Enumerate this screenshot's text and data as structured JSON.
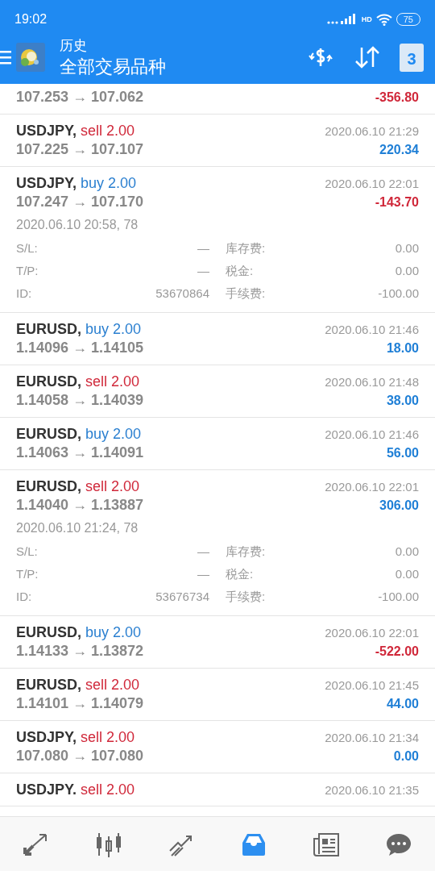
{
  "status_bar": {
    "time": "19:02",
    "network_badge": "HD",
    "battery": "75"
  },
  "header": {
    "title": "历史",
    "subtitle": "全部交易品种",
    "calendar_day": "3"
  },
  "trades": [
    {
      "prices": "107.253 → 107.062",
      "profit": "-356.80",
      "loss": true
    },
    {
      "symbol": "USDJPY,",
      "side": "sell",
      "volume": "2.00",
      "prices": "107.225 → 107.107",
      "time": "2020.06.10 21:29",
      "profit": "220.34",
      "loss": false
    },
    {
      "symbol": "USDJPY,",
      "side": "buy",
      "volume": "2.00",
      "prices": "107.247 → 107.170",
      "time": "2020.06.10 22:01",
      "profit": "-143.70",
      "loss": true,
      "details": {
        "opened": "2020.06.10 20:58, 78",
        "rows": [
          {
            "label": "S/L:",
            "value": "—",
            "label2": "库存费:",
            "value2": "0.00"
          },
          {
            "label": "T/P:",
            "value": "—",
            "label2": "税金:",
            "value2": "0.00"
          },
          {
            "label": "ID:",
            "value": "53670864",
            "label2": "手续费:",
            "value2": "-100.00"
          }
        ]
      }
    },
    {
      "symbol": "EURUSD,",
      "side": "buy",
      "volume": "2.00",
      "prices": "1.14096 → 1.14105",
      "time": "2020.06.10 21:46",
      "profit": "18.00",
      "loss": false
    },
    {
      "symbol": "EURUSD,",
      "side": "sell",
      "volume": "2.00",
      "prices": "1.14058 → 1.14039",
      "time": "2020.06.10 21:48",
      "profit": "38.00",
      "loss": false
    },
    {
      "symbol": "EURUSD,",
      "side": "buy",
      "volume": "2.00",
      "prices": "1.14063 → 1.14091",
      "time": "2020.06.10 21:46",
      "profit": "56.00",
      "loss": false
    },
    {
      "symbol": "EURUSD,",
      "side": "sell",
      "volume": "2.00",
      "prices": "1.14040 → 1.13887",
      "time": "2020.06.10 22:01",
      "profit": "306.00",
      "loss": false,
      "details": {
        "opened": "2020.06.10 21:24, 78",
        "rows": [
          {
            "label": "S/L:",
            "value": "—",
            "label2": "库存费:",
            "value2": "0.00"
          },
          {
            "label": "T/P:",
            "value": "—",
            "label2": "税金:",
            "value2": "0.00"
          },
          {
            "label": "ID:",
            "value": "53676734",
            "label2": "手续费:",
            "value2": "-100.00"
          }
        ]
      }
    },
    {
      "symbol": "EURUSD,",
      "side": "buy",
      "volume": "2.00",
      "prices": "1.14133 → 1.13872",
      "time": "2020.06.10 22:01",
      "profit": "-522.00",
      "loss": true
    },
    {
      "symbol": "EURUSD,",
      "side": "sell",
      "volume": "2.00",
      "prices": "1.14101 → 1.14079",
      "time": "2020.06.10 21:45",
      "profit": "44.00",
      "loss": false
    },
    {
      "symbol": "USDJPY,",
      "side": "sell",
      "volume": "2.00",
      "prices": "107.080 → 107.080",
      "time": "2020.06.10 21:34",
      "profit": "0.00",
      "loss": false
    },
    {
      "symbol": "USDJPY.",
      "side": "sell",
      "volume": "2.00",
      "time": "2020.06.10 21:35"
    }
  ],
  "nav": [
    {
      "kind": "trade",
      "selected": false
    },
    {
      "kind": "chart",
      "selected": false
    },
    {
      "kind": "trend",
      "selected": false
    },
    {
      "kind": "history",
      "selected": true
    },
    {
      "kind": "news",
      "selected": false
    },
    {
      "kind": "chat",
      "selected": false
    }
  ]
}
